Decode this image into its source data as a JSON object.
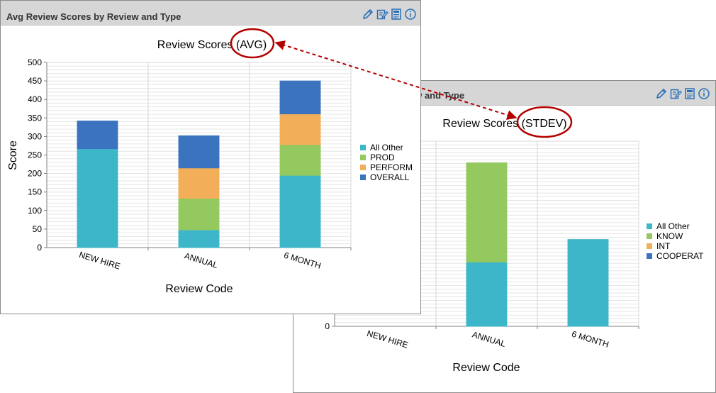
{
  "colors": {
    "all_other": "#3db6c9",
    "green": "#93c95e",
    "orange": "#f3ae5a",
    "blue": "#3b73be",
    "annotation": "#b30000"
  },
  "icons": [
    "pencil-icon",
    "edit-notes-icon",
    "report-icon",
    "info-icon"
  ],
  "panel_avg": {
    "title": "Avg Review Scores by Review and Type",
    "chart_data": {
      "type": "bar",
      "stacked": true,
      "title": "Review Scores (AVG)",
      "xlabel": "Review Code",
      "ylabel": "Score",
      "categories": [
        "NEW HIRE",
        "ANNUAL",
        "6 MONTH"
      ],
      "ylim": [
        0,
        500
      ],
      "yticks": [
        0,
        50,
        100,
        150,
        200,
        250,
        300,
        350,
        400,
        450,
        500
      ],
      "grid": true,
      "legend": "right",
      "series": [
        {
          "name": "All Other",
          "values": [
            267,
            48,
            195
          ]
        },
        {
          "name": "PROD",
          "values": [
            0,
            85,
            83
          ]
        },
        {
          "name": "PERFORM",
          "values": [
            0,
            82,
            83
          ]
        },
        {
          "name": "OVERALL",
          "values": [
            75,
            87,
            89
          ]
        }
      ]
    }
  },
  "panel_stdev": {
    "title": "ew and Type",
    "chart_data": {
      "type": "bar",
      "stacked": true,
      "title": "Review Scores (STDEV)",
      "xlabel": "Review Code",
      "categories": [
        "NEW HIRE",
        "ANNUAL",
        "6 MONTH"
      ],
      "ylim": [
        0,
        1
      ],
      "yticks": [
        0
      ],
      "grid": true,
      "legend": "right",
      "series": [
        {
          "name": "All Other",
          "values": [
            0,
            0.347,
            0.469
          ]
        },
        {
          "name": "KNOW",
          "values": [
            0,
            0.536,
            0
          ]
        },
        {
          "name": "INT",
          "values": [
            0,
            0,
            0
          ]
        },
        {
          "name": "COOPERAT",
          "values": [
            0,
            0,
            0
          ]
        }
      ]
    }
  }
}
